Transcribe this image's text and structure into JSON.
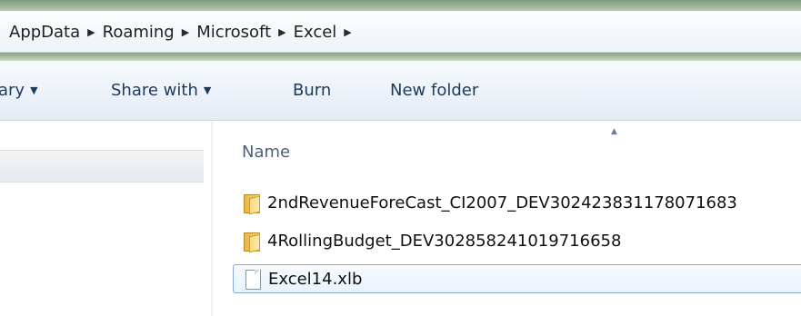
{
  "breadcrumb": {
    "items": [
      "AppData",
      "Roaming",
      "Microsoft",
      "Excel"
    ],
    "separator": "▶"
  },
  "toolbar": {
    "library_label": "ary",
    "share_label": "Share with",
    "burn_label": "Burn",
    "new_folder_label": "New folder",
    "dropdown_glyph": "▼"
  },
  "file_list": {
    "column_name": "Name",
    "sort_glyph": "▲",
    "files": [
      {
        "name": "2ndRevenueForeCast_CI2007_DEV302423831178071683",
        "type": "folder"
      },
      {
        "name": "4RollingBudget_DEV302858241019716658",
        "type": "folder"
      },
      {
        "name": "Excel14.xlb",
        "type": "file"
      }
    ]
  },
  "colors": {
    "toolbar_text": "#1e395b",
    "selection_border": "#84acdd",
    "column_header": "#4c607a"
  }
}
